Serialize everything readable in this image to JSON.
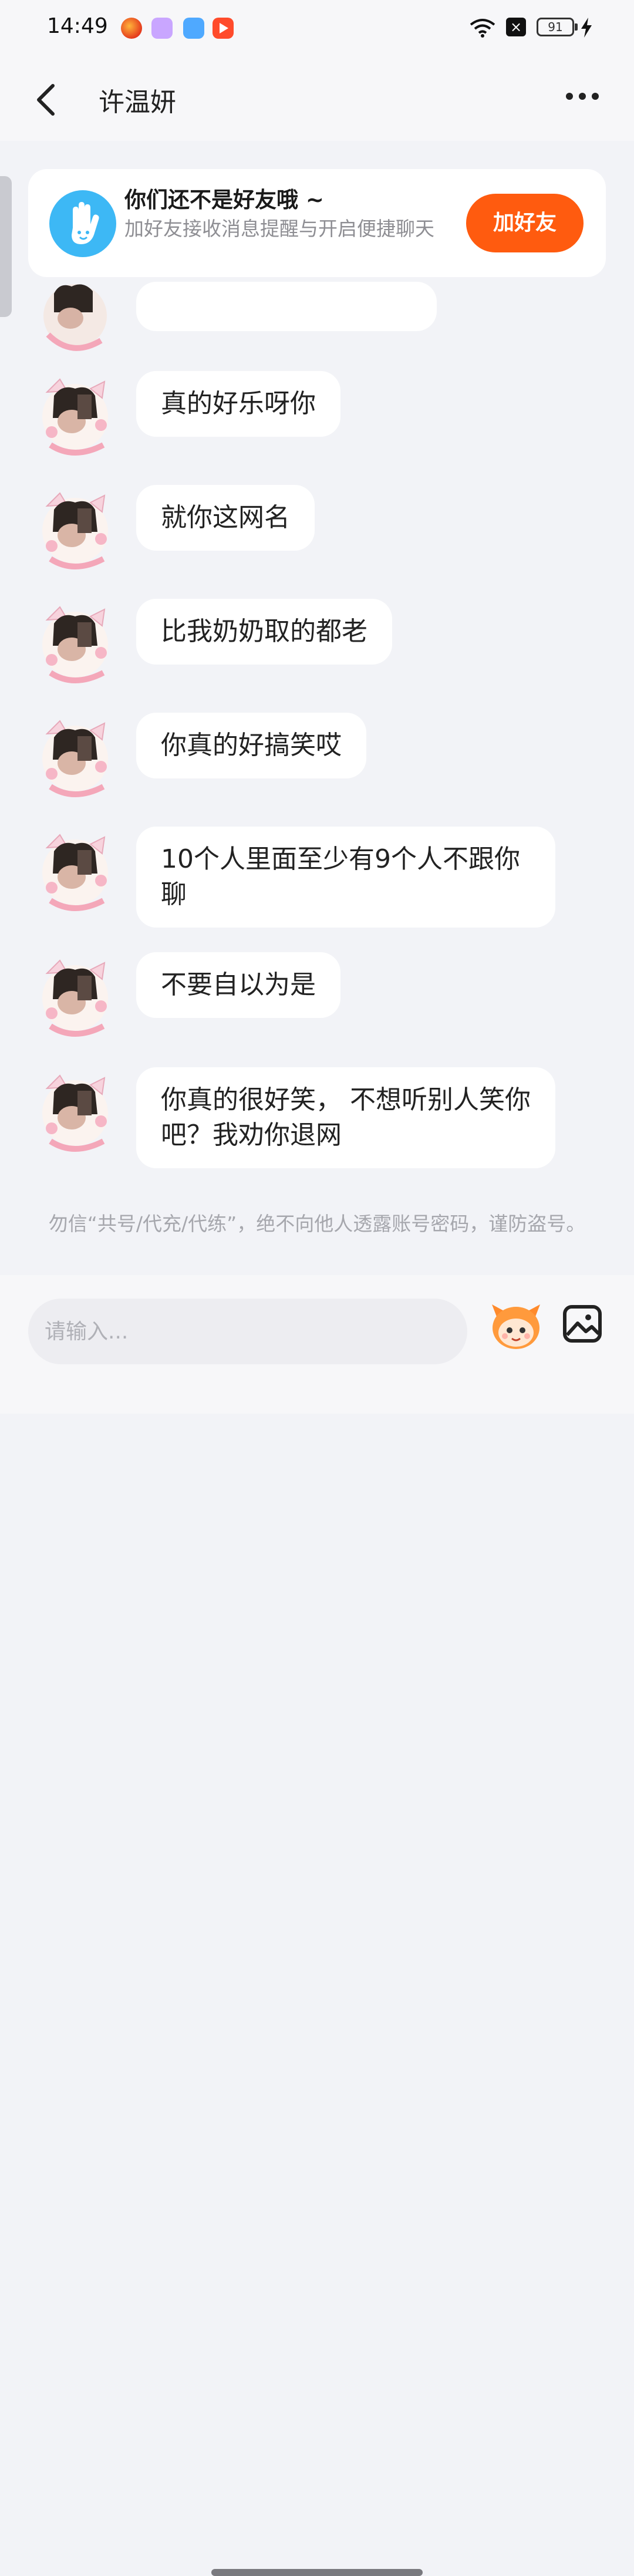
{
  "status_bar": {
    "time": "14:49",
    "battery": "91"
  },
  "header": {
    "title": "许温妍"
  },
  "friend_banner": {
    "title": "你们还不是好友哦 ~",
    "subtitle": "加好友接收消息提醒与开启便捷聊天",
    "button_label": "加好友"
  },
  "messages": [
    {
      "text": "真的好乐呀你"
    },
    {
      "text": "就你这网名"
    },
    {
      "text": "比我奶奶取的都老"
    },
    {
      "text": "你真的好搞笑哎"
    },
    {
      "text": "10个人里面至少有9个人不跟你聊"
    },
    {
      "text": "不要自以为是"
    },
    {
      "text": "你真的很好笑， 不想听别人笑你吧？我劝你退网"
    }
  ],
  "security_notice": "勿信“共号/代充/代练”，绝不向他人透露账号密码，谨防盗号。",
  "input": {
    "placeholder": "请输入..."
  },
  "icons": {
    "back": "back-arrow-icon",
    "more": "more-dots-icon",
    "wave": "hand-wave-icon",
    "emoji": "emoji-sticker-icon",
    "image": "image-picker-icon"
  },
  "colors": {
    "accent": "#FF5B0F",
    "banner_icon": "#3DB8F5",
    "background": "#F2F3F7",
    "bubble": "#FFFFFF"
  }
}
